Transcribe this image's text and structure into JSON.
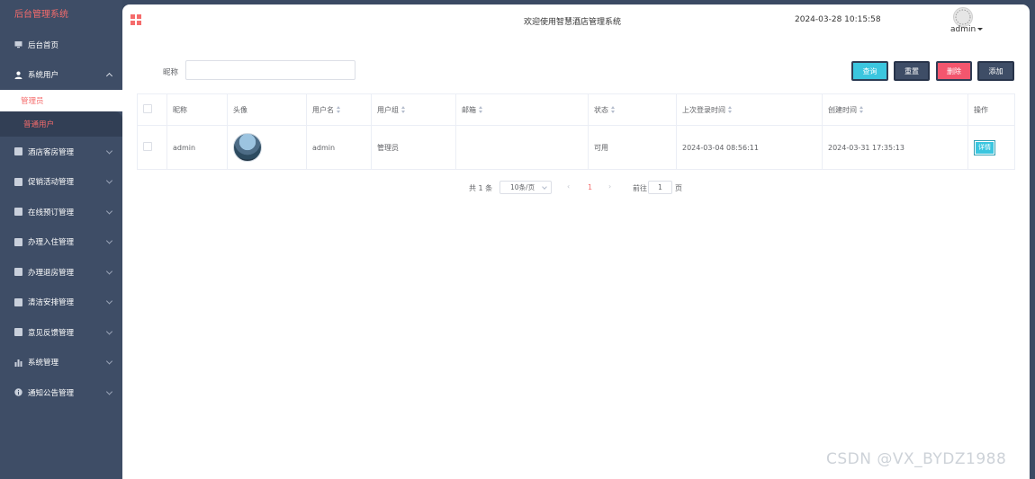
{
  "app": {
    "title": "后台管理系统"
  },
  "sidebar": {
    "items": [
      {
        "label": "后台首页",
        "icon": "monitor-icon"
      },
      {
        "label": "系统用户",
        "icon": "user-icon",
        "expanded": true,
        "children": [
          {
            "label": "管理员",
            "active": true
          },
          {
            "label": "普通用户"
          }
        ]
      },
      {
        "label": "酒店客房管理",
        "icon": "list-icon"
      },
      {
        "label": "促销活动管理",
        "icon": "list-icon"
      },
      {
        "label": "在线预订管理",
        "icon": "list-icon"
      },
      {
        "label": "办理入住管理",
        "icon": "list-icon"
      },
      {
        "label": "办理退房管理",
        "icon": "list-icon"
      },
      {
        "label": "清洁安排管理",
        "icon": "list-icon"
      },
      {
        "label": "意见反馈管理",
        "icon": "list-icon"
      },
      {
        "label": "系统管理",
        "icon": "bar-chart-icon"
      },
      {
        "label": "通知公告管理",
        "icon": "info-icon"
      }
    ]
  },
  "header": {
    "welcome": "欢迎使用智慧酒店管理系统",
    "datetime": "2024-03-28 10:15:58",
    "user": "admin"
  },
  "search": {
    "nickname_label": "昵称",
    "nickname_value": ""
  },
  "toolbar": {
    "query": "查询",
    "reset": "重置",
    "delete": "删除",
    "add": "添加"
  },
  "table": {
    "columns": [
      "昵称",
      "头像",
      "用户名",
      "用户组",
      "邮箱",
      "状态",
      "上次登录时间",
      "创建时间",
      "操作"
    ],
    "rows": [
      {
        "nickname": "admin",
        "username": "admin",
        "group": "管理员",
        "email": "",
        "status": "可用",
        "last_login": "2024-03-04 08:56:11",
        "created": "2024-03-31 17:35:13",
        "action": "详情"
      }
    ]
  },
  "pagination": {
    "total": "共 1 条",
    "page_size": "10条/页",
    "prev": "‹",
    "current": "1",
    "next": "›",
    "goto_label": "前往",
    "goto_value": "1",
    "page_suffix": "页"
  },
  "watermark": "CSDN @VX_BYDZ1988",
  "colors": {
    "accent": "#f56c6c",
    "sidebar": "#3e4d66",
    "query": "#3bc6df",
    "delete": "#f3566e"
  }
}
